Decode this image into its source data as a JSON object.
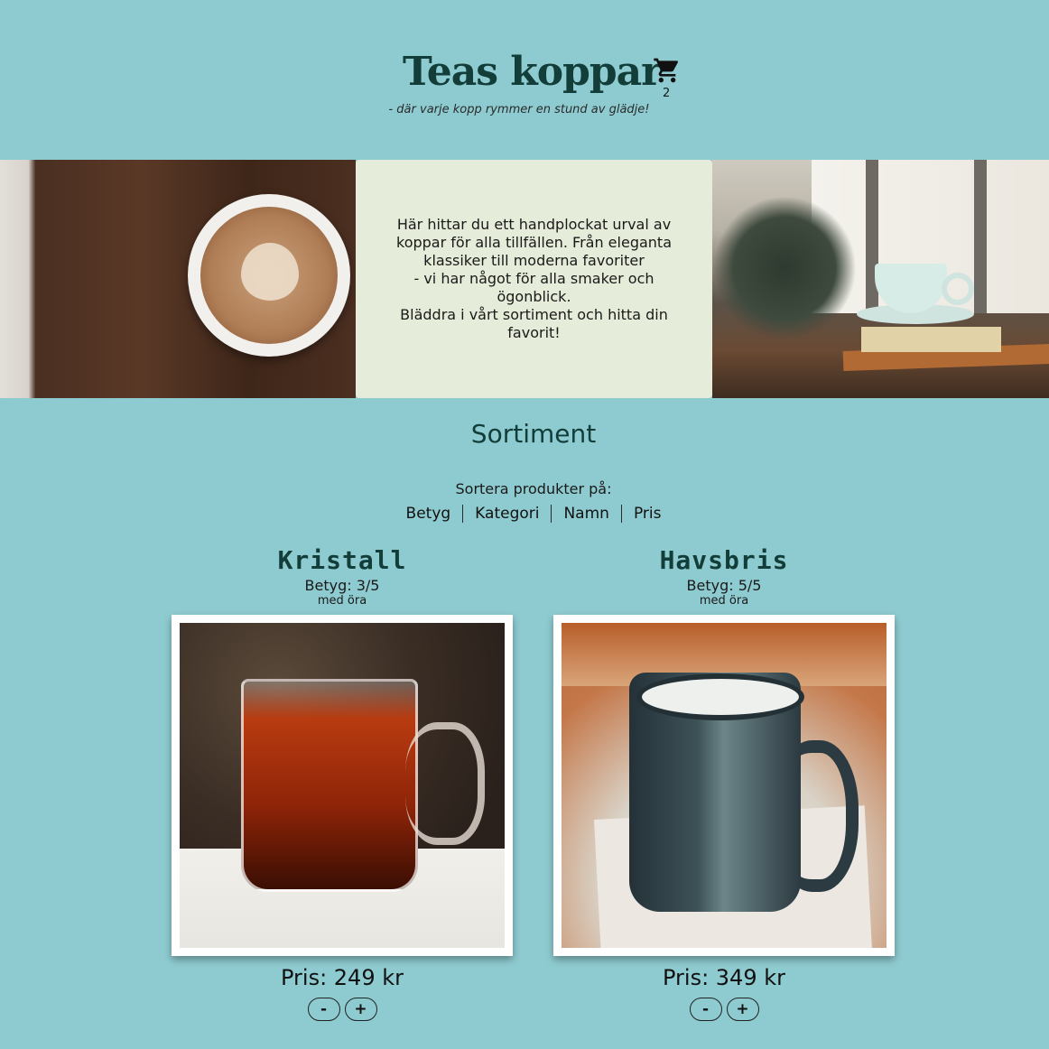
{
  "header": {
    "title": "Teas koppar",
    "tagline": "- där varje kopp rymmer en stund av glädje!",
    "cart": {
      "icon": "cart-icon",
      "count": "2"
    }
  },
  "hero": {
    "text": "Här hittar du ett handplockat urval av koppar för alla tillfällen. Från eleganta klassiker till moderna favoriter\n- vi har något för alla smaker och ögonblick.\nBläddra i vårt sortiment och hitta din favorit!"
  },
  "catalog": {
    "title": "Sortiment",
    "sort_label": "Sortera produkter på:",
    "sort_options": [
      "Betyg",
      "Kategori",
      "Namn",
      "Pris"
    ]
  },
  "products": [
    {
      "name": "Kristall",
      "rating": "Betyg: 3/5",
      "category": "med öra",
      "price": "Pris: 249 kr",
      "minus": "-",
      "plus": "+"
    },
    {
      "name": "Havsbris",
      "rating": "Betyg: 5/5",
      "category": "med öra",
      "price": "Pris: 349 kr",
      "minus": "-",
      "plus": "+"
    }
  ],
  "colors": {
    "background": "#8ecbd0",
    "title": "#123d38",
    "hero_box": "#e5ecd9"
  }
}
